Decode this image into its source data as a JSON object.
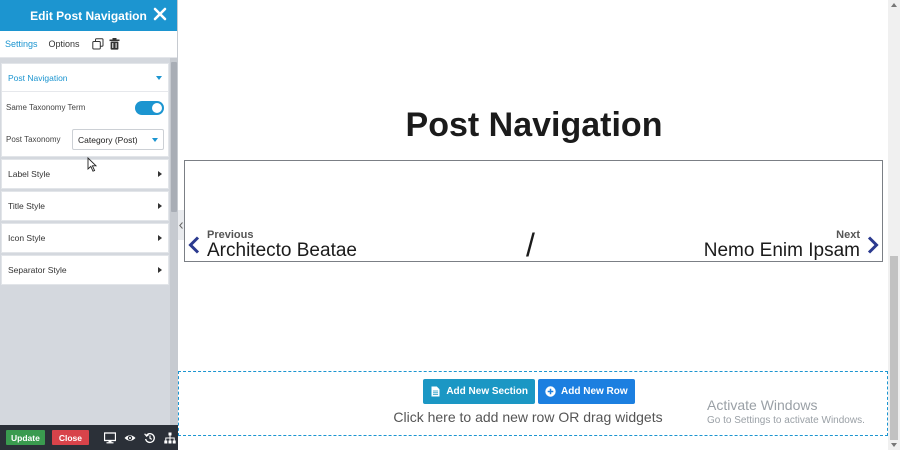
{
  "panel": {
    "title": "Edit Post Navigation",
    "tabs": [
      "Settings",
      "Options"
    ],
    "sections": {
      "post_navigation": "Post Navigation",
      "label_style": "Label Style",
      "title_style": "Title Style",
      "icon_style": "Icon Style",
      "separator_style": "Separator Style"
    },
    "same_taxonomy_label": "Same Taxonomy Term",
    "same_taxonomy_enabled": true,
    "post_taxonomy_label": "Post Taxonomy",
    "post_taxonomy_value": "Category (Post)",
    "footer": {
      "update": "Update",
      "close": "Close"
    }
  },
  "canvas": {
    "heading": "Post Navigation",
    "prev_label": "Previous",
    "prev_title": "Architecto Beatae",
    "separator": "/",
    "next_label": "Next",
    "next_title": "Nemo Enim Ipsam",
    "add_section": "Add New Section",
    "add_row": "Add New Row",
    "drop_hint": "Click here to add new row OR drag widgets"
  },
  "watermark": {
    "title": "Activate Windows",
    "subtitle": "Go to Settings to activate Windows."
  },
  "colors": {
    "accent": "#1c95d0",
    "update": "#3a9b4f",
    "close": "#d8434a",
    "nav_chevron": "#2b3a8f"
  }
}
